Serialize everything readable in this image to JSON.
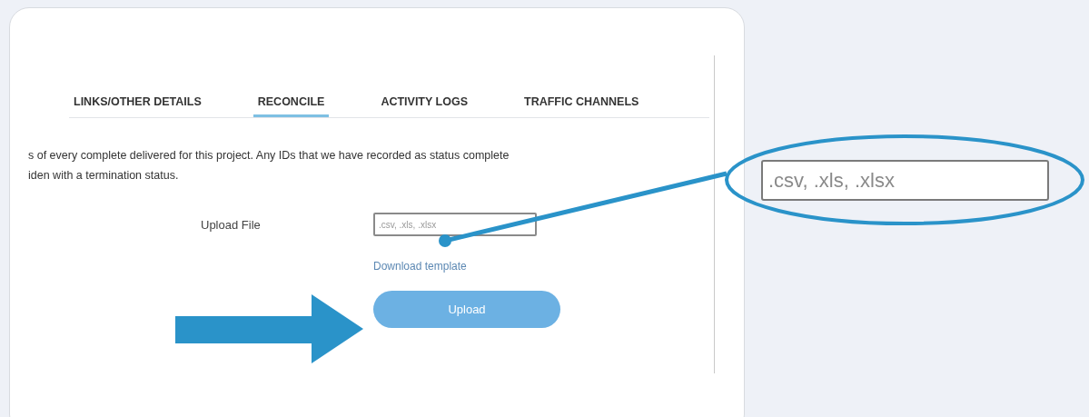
{
  "tabs": [
    {
      "label": "LINKS/OTHER DETAILS",
      "selected": false
    },
    {
      "label": "RECONCILE",
      "selected": true
    },
    {
      "label": "ACTIVITY LOGS",
      "selected": false
    },
    {
      "label": "TRAFFIC CHANNELS",
      "selected": false
    }
  ],
  "description": "s of every complete delivered for this project. Any IDs that we have recorded as status complete\niden with a termination status.",
  "upload_form": {
    "label": "Upload File",
    "file_field": {
      "placeholder": ".csv, .xls, .xlsx"
    },
    "download_link": "Download template",
    "upload_button": "Upload"
  },
  "callout": {
    "zoomed_field": {
      "placeholder": ".csv, .xls, .xlsx"
    }
  }
}
